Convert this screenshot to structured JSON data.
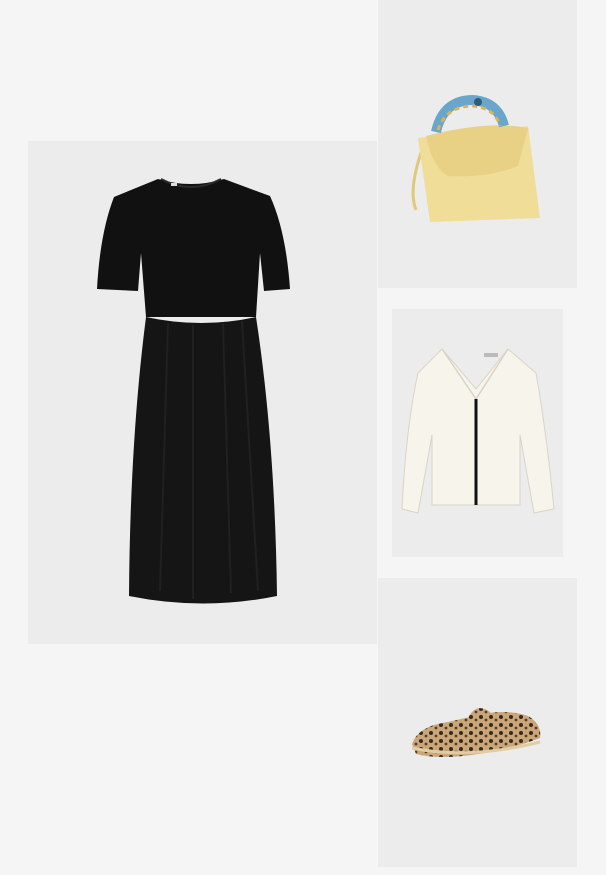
{
  "items": [
    {
      "id": "dress",
      "icon": "black-tshirt-dress",
      "colors": {
        "fill": "#111111",
        "background": "#ececec"
      }
    },
    {
      "id": "bag",
      "icon": "yellow-handbag-scarf-handle",
      "colors": {
        "fill": "#efd98f",
        "accent": "#5fa0c8",
        "background": "#ececec"
      }
    },
    {
      "id": "top",
      "icon": "white-vneck-blouse",
      "colors": {
        "fill": "#f6f3ea",
        "accent": "#111111",
        "background": "#ececec"
      }
    },
    {
      "id": "shoes",
      "icon": "leopard-loafer",
      "colors": {
        "fill": "#c9a77a",
        "accent": "#3a2a1c",
        "background": "#ececec"
      }
    }
  ]
}
